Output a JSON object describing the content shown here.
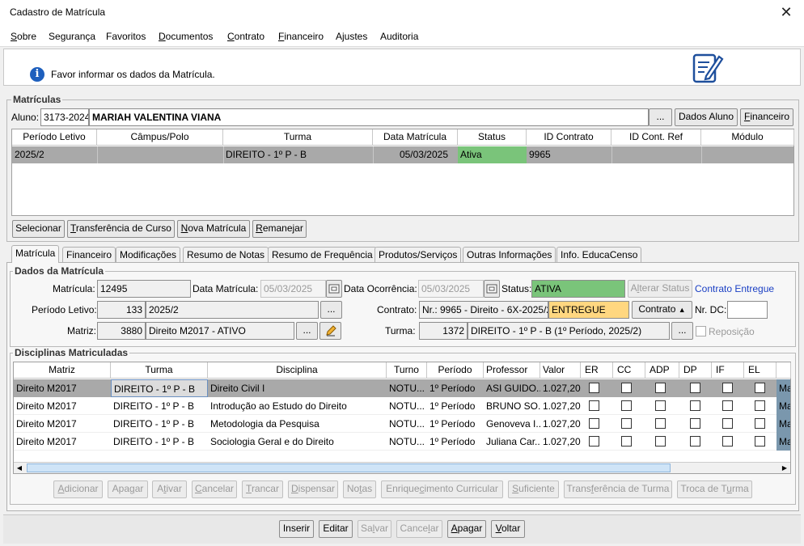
{
  "window": {
    "title": "Cadastro de Matrícula",
    "close_glyph": "✕"
  },
  "menu": [
    {
      "pre": "",
      "ul": "S",
      "post": "obre"
    },
    {
      "pre": "Se",
      "ul": "g",
      "post": "urança"
    },
    {
      "pre": "Favoritos",
      "ul": "",
      "post": ""
    },
    {
      "pre": "",
      "ul": "D",
      "post": "ocumentos"
    },
    {
      "pre": "",
      "ul": "C",
      "post": "ontrato"
    },
    {
      "pre": "",
      "ul": "F",
      "post": "inanceiro"
    },
    {
      "pre": "Ajustes",
      "ul": "",
      "post": ""
    },
    {
      "pre": "Auditoria",
      "ul": "",
      "post": ""
    }
  ],
  "info": {
    "icon": "info-icon",
    "text": "Favor informar os dados da Matrícula."
  },
  "matriculas": {
    "label": "Matrículas",
    "aluno_label": "Aluno:",
    "aluno_id": "3173-2024",
    "aluno_name": "MARIAH VALENTINA VIANA",
    "ellipsis": "...",
    "dados_aluno": "Dados Aluno",
    "financeiro": "Financeiro",
    "columns": [
      "Período Letivo",
      "Câmpus/Polo",
      "Turma",
      "Data Matrícula",
      "Status",
      "ID Contrato",
      "ID Cont. Ref",
      "Módulo"
    ],
    "rows": [
      [
        "2025/2",
        "",
        "DIREITO - 1º P - B",
        "05/03/2025",
        "Ativa",
        "9965",
        "",
        ""
      ]
    ],
    "status_color": "#7ac47a",
    "buttons": [
      "Selecionar",
      "Transferência de Curso",
      "Nova Matrícula",
      "Remanejar"
    ]
  },
  "tabs": [
    "Matrícula",
    "Financeiro",
    "Modificações",
    "Resumo de Notas",
    "Resumo de Frequência",
    "Produtos/Serviços",
    "Outras Informações",
    "Info. EducaCenso"
  ],
  "dados": {
    "label": "Dados da Matrícula",
    "matricula_label": "Matrícula:",
    "matricula": "12495",
    "data_matricula_label": "Data Matrícula:",
    "data_matricula": "05/03/2025",
    "data_ocorrencia_label": "Data Ocorrência:",
    "data_ocorrencia": "05/03/2025",
    "status_label": "Status:",
    "status": "ATIVA",
    "alterar_status": "Alterar Status",
    "contrato_entregue": "Contrato Entregue",
    "periodo_label": "Período Letivo:",
    "periodo_id": "133",
    "periodo": "2025/2",
    "contrato_label": "Contrato:",
    "contrato": "Nr.: 9965 - Direito - 6X-2025/2",
    "contrato_status": "ENTREGUE",
    "contrato_btn": "Contrato",
    "nr_dc_label": "Nr. DC:",
    "nr_dc": "",
    "matriz_label": "Matriz:",
    "matriz_id": "3880",
    "matriz": "Direito M2017 - ATIVO",
    "turma_label": "Turma:",
    "turma_id": "1372",
    "turma": "DIREITO - 1º P - B (1º Período, 2025/2)",
    "reposicao": "Reposição"
  },
  "disciplinas": {
    "label": "Disciplinas Matriculadas",
    "columns": [
      "Matriz",
      "Turma",
      "Disciplina",
      "Turno",
      "Período",
      "Professor",
      "Valor",
      "ER",
      "CC",
      "ADP",
      "DP",
      "IF",
      "EL"
    ],
    "rows": [
      [
        "Direito M2017",
        "DIREITO - 1º P - B",
        "Direito Civil I",
        "NOTU...",
        "1º Período",
        "ASI GUIDO...",
        "1.027,20",
        "Ma"
      ],
      [
        "Direito M2017",
        "DIREITO - 1º P - B",
        "Introdução ao Estudo do Direito",
        "NOTU...",
        "1º Período",
        "BRUNO SO...",
        "1.027,20",
        "Ma"
      ],
      [
        "Direito M2017",
        "DIREITO - 1º P - B",
        "Metodologia da Pesquisa",
        "NOTU...",
        "1º Período",
        "Genoveva I...",
        "1.027,20",
        "Ma"
      ],
      [
        "Direito M2017",
        "DIREITO - 1º P - B",
        "Sociologia Geral e do Direito",
        "NOTU...",
        "1º Período",
        "Juliana Car...",
        "1.027,20",
        "Ma"
      ]
    ],
    "buttons": [
      "Adicionar",
      "Apagar",
      "Ativar",
      "Cancelar",
      "Trancar",
      "Dispensar",
      "Notas",
      "Enriquecimento Curricular",
      "Suficiente",
      "Transferência de Turma",
      "Troca de Turma"
    ]
  },
  "bottom_buttons": [
    "Inserir",
    "Editar",
    "Salvar",
    "Cancelar",
    "Apagar",
    "Voltar"
  ],
  "colors": {
    "accent_link": "#1a3fc4",
    "selected_row": "#a9a9a9",
    "status_green": "#7ac47a",
    "entregue_yellow": "#ffd780"
  }
}
